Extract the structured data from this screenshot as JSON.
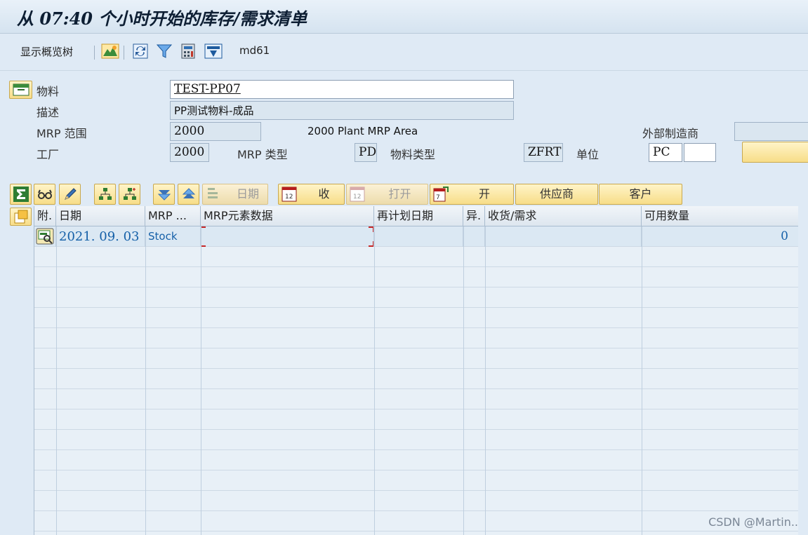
{
  "window": {
    "title": "从 07:40 个小时开始的库存/需求清单"
  },
  "toolbar": {
    "overview_tree_label": "显示概览树",
    "icons": [
      "overview-chart-icon",
      "refresh-icon",
      "filter-icon",
      "calculator-icon",
      "transfer-icon"
    ],
    "transaction_code": "md61"
  },
  "header": {
    "material_label": "物料",
    "material_value": "TEST-PP07",
    "description_label": "描述",
    "description_value": "PP测试物料-成品",
    "mrp_area_label": "MRP 范围",
    "mrp_area_value": "2000",
    "mrp_area_text": "2000 Plant  MRP Area",
    "ext_manufacturer_label": "外部制造商",
    "ext_manufacturer_value": "",
    "plant_label": "工厂",
    "plant_value": "2000",
    "mrp_type_label": "MRP 类型",
    "mrp_type_value": "PD",
    "material_type_label": "物料类型",
    "material_type_value": "ZFRT",
    "unit_label": "单位",
    "unit_value": "PC",
    "unit_extra": ""
  },
  "action_bar": {
    "date_label": "日期",
    "receipts_label": "收",
    "open_disabled_label": "打开",
    "open_label": "开",
    "vendor_label": "供应商",
    "customer_label": "客户"
  },
  "grid": {
    "columns": [
      "附.",
      "日期",
      "MRP ...",
      "MRP元素数据",
      "再计划日期",
      "异.",
      "收货/需求",
      "可用数量"
    ],
    "rows": [
      {
        "date": "2021. 09. 03",
        "mrp_element": "Stock",
        "element_data": "",
        "reschedule": "",
        "exception": "",
        "receipt_req": "",
        "available_qty": "0"
      }
    ]
  },
  "watermark": "CSDN @Martin.."
}
